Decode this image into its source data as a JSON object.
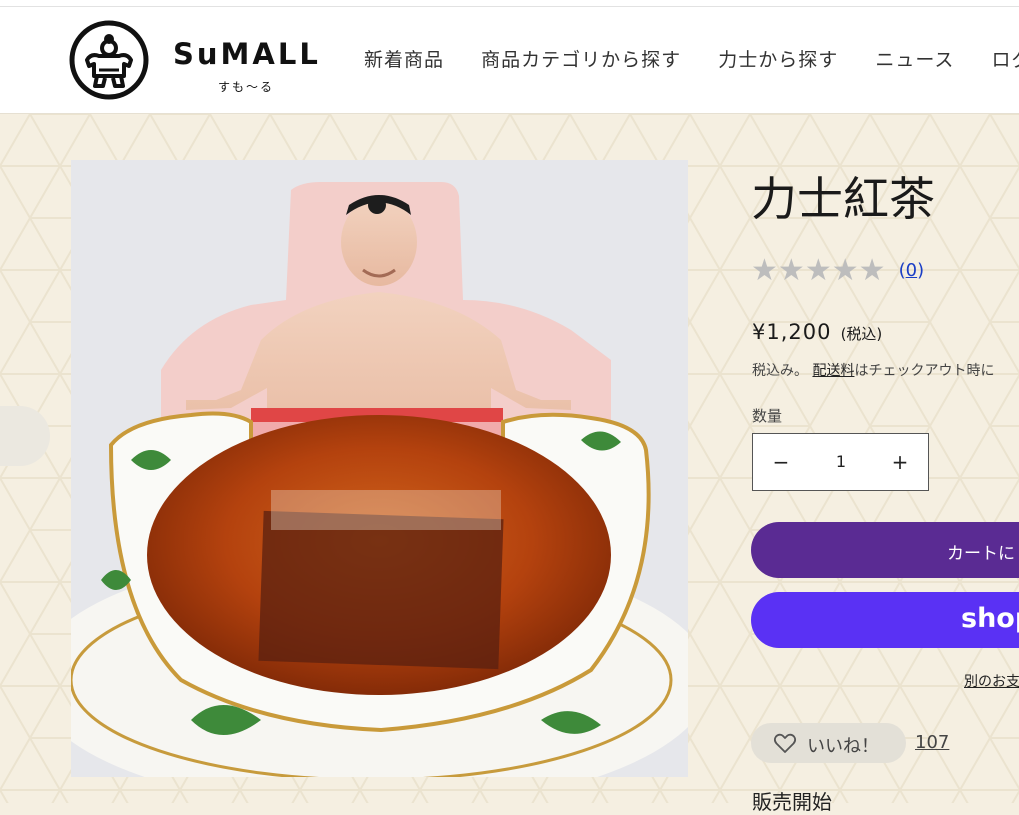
{
  "header": {
    "logo_text": "SuMALL",
    "logo_sub": "すも〜る",
    "nav": [
      {
        "label": "新着商品"
      },
      {
        "label": "商品カテゴリから探す"
      },
      {
        "label": "力士から探す"
      },
      {
        "label": "ニュース"
      },
      {
        "label": "ログ"
      }
    ]
  },
  "product": {
    "title": "力士紅茶",
    "rating": {
      "stars": 0,
      "max": 5,
      "count_text": "0"
    },
    "price": "¥1,200",
    "price_tax_label": "(税込)",
    "tax_note_prefix": "税込み。",
    "tax_note_link": "配送料",
    "tax_note_suffix": "はチェックアウト時に",
    "quantity_label": "数量",
    "quantity_value": "1",
    "minus_symbol": "−",
    "plus_symbol": "+",
    "add_to_cart_label": "カートに",
    "shop_pay_label": "shop",
    "alt_payment_label": "別のお支",
    "like_label": "いいね！",
    "like_count": "107",
    "sale_start_label": "販売開始"
  },
  "colors": {
    "background": "#f5efe1",
    "cart_button": "#5a2b93",
    "shop_pay_button": "#5a31f4",
    "star_empty": "#bdbdbd",
    "link": "#1a3ec6"
  },
  "icons": [
    "sumo-logo-icon",
    "star-icon",
    "heart-icon",
    "minus-icon",
    "plus-icon"
  ]
}
